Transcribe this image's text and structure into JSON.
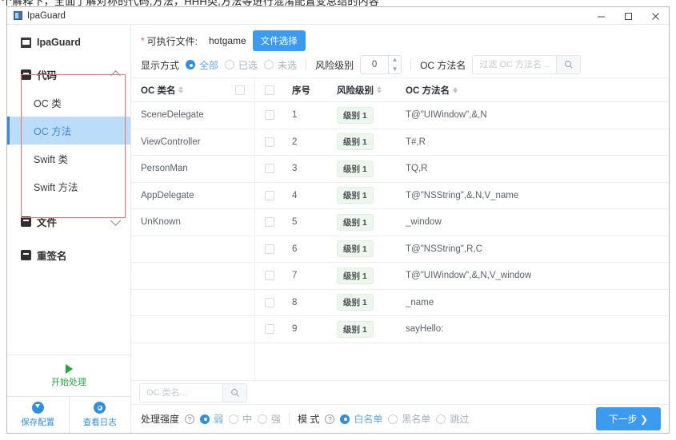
{
  "page_top_note": "个解释下，全面了解对称的代码,方法，HHH类,方法等进行混淆配置变总结的内容",
  "window": {
    "title": "IpaGuard",
    "controls": {
      "minimize": "minimize-icon",
      "maximize": "maximize-icon",
      "close": "close-icon"
    }
  },
  "sidebar": {
    "brand": "IpaGuard",
    "groups": [
      {
        "label": "代码",
        "icon": "code-icon",
        "expanded": true,
        "chevron": "chevron-up-icon",
        "items": [
          {
            "label": "OC 类",
            "active": false
          },
          {
            "label": "OC 方法",
            "active": true
          },
          {
            "label": "Swift 类",
            "active": false
          },
          {
            "label": "Swift 方法",
            "active": false
          }
        ]
      },
      {
        "label": "文件",
        "icon": "file-icon",
        "expanded": false,
        "chevron": "chevron-down-icon",
        "items": []
      },
      {
        "label": "重签名",
        "icon": "resign-icon",
        "expanded": false,
        "chevron": "",
        "items": []
      }
    ],
    "start": {
      "label": "开始处理",
      "icon": "play-icon"
    },
    "actions": [
      {
        "label": "保存配置",
        "icon": "save-download-icon"
      },
      {
        "label": "查看日志",
        "icon": "eye-log-icon"
      }
    ]
  },
  "toolbar": {
    "file_label": "可执行文件:",
    "file_required_mark": "*",
    "file_value": "hotgame",
    "file_button": "文件选择",
    "display_mode_label": "显示方式",
    "display_modes": [
      {
        "label": "全部",
        "selected": true
      },
      {
        "label": "已选",
        "selected": false
      },
      {
        "label": "未选",
        "selected": false
      }
    ],
    "risk_level_label": "风险级别",
    "risk_level_value": "0",
    "method_name_label": "OC 方法名",
    "method_filter_placeholder": "过滤 OC 方法名 ...",
    "method_filter_value": "",
    "search_icon": "search-icon"
  },
  "left_table": {
    "columns": [
      {
        "label": "OC 类名",
        "sortable": true
      },
      {
        "label": "",
        "type": "checkbox"
      }
    ],
    "rows": [
      {
        "name": "SceneDelegate"
      },
      {
        "name": "ViewController"
      },
      {
        "name": "PersonMan"
      },
      {
        "name": "AppDelegate"
      },
      {
        "name": "UnKnown"
      }
    ],
    "empty_rows": 4,
    "filter_placeholder": "OC 类名...",
    "filter_value": ""
  },
  "right_table": {
    "columns": [
      {
        "label": "",
        "type": "checkbox"
      },
      {
        "label": "序号",
        "sortable": false
      },
      {
        "label": "风险级别",
        "sortable": true
      },
      {
        "label": "OC 方法名",
        "sortable": true
      }
    ],
    "rows": [
      {
        "no": "1",
        "risk": "级别 1",
        "name": "T@\"UIWindow\",&,N",
        "checked": false
      },
      {
        "no": "2",
        "risk": "级别 1",
        "name": "T#,R",
        "checked": false
      },
      {
        "no": "3",
        "risk": "级别 1",
        "name": "TQ,R",
        "checked": false
      },
      {
        "no": "4",
        "risk": "级别 1",
        "name": "T@\"NSString\",&,N,V_name",
        "checked": false
      },
      {
        "no": "5",
        "risk": "级别 1",
        "name": "_window",
        "checked": false
      },
      {
        "no": "6",
        "risk": "级别 1",
        "name": "T@\"NSString\",R,C",
        "checked": false
      },
      {
        "no": "7",
        "risk": "级别 1",
        "name": "T@\"UIWindow\",&,N,V_window",
        "checked": false
      },
      {
        "no": "8",
        "risk": "级别 1",
        "name": "_name",
        "checked": false
      },
      {
        "no": "9",
        "risk": "级别 1",
        "name": "sayHello:",
        "checked": false
      }
    ]
  },
  "footer": {
    "strength_label": "处理强度",
    "strength_help": "?",
    "strength_options": [
      {
        "label": "弱",
        "selected": true
      },
      {
        "label": "中",
        "selected": false
      },
      {
        "label": "强",
        "selected": false
      }
    ],
    "mode_label": "模 式",
    "mode_help": "?",
    "mode_options": [
      {
        "label": "白名单",
        "selected": true
      },
      {
        "label": "黑名单",
        "selected": false
      },
      {
        "label": "跳过",
        "selected": false
      }
    ],
    "next_button": "下一步 ❯"
  },
  "colors": {
    "accent": "#3a9bf0",
    "active_nav_bg": "#bcddf9",
    "active_nav_text": "#3f87d6",
    "badge_bg": "#eef7ee",
    "start_green": "#22a73f",
    "highlight_box": "#f26d6d",
    "required_red": "#e8604c"
  }
}
